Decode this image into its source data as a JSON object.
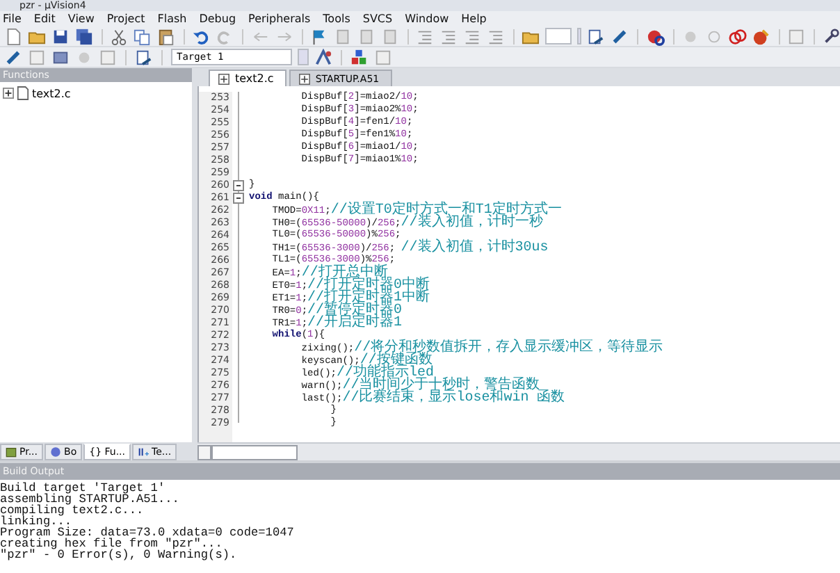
{
  "window": {
    "title": "pzr - µVision4"
  },
  "menu": [
    "File",
    "Edit",
    "View",
    "Project",
    "Flash",
    "Debug",
    "Peripherals",
    "Tools",
    "SVCS",
    "Window",
    "Help"
  ],
  "toolbar": {
    "target": "Target 1"
  },
  "functions_panel": {
    "title": "Functions",
    "items": [
      {
        "label": "text2.c",
        "expanded": false
      }
    ],
    "tabs": [
      {
        "label": "Pr...",
        "selected": false
      },
      {
        "label": "Bo",
        "selected": false
      },
      {
        "label": "{} Fu...",
        "selected": true
      },
      {
        "label": "Te...",
        "selected": false
      }
    ]
  },
  "editor": {
    "tabs": [
      {
        "label": "text2.c",
        "selected": true
      },
      {
        "label": "STARTUP.A51",
        "selected": false
      }
    ],
    "lines": [
      {
        "number": "253",
        "fold_toggle": false,
        "parts": [
          {
            "kind": "code",
            "text": "         DispBuf["
          },
          {
            "kind": "num",
            "text": "2"
          },
          {
            "kind": "code",
            "text": "]=miao2/"
          },
          {
            "kind": "num",
            "text": "10"
          },
          {
            "kind": "code",
            "text": ";"
          }
        ]
      },
      {
        "number": "254",
        "fold_toggle": false,
        "parts": [
          {
            "kind": "code",
            "text": "         DispBuf["
          },
          {
            "kind": "num",
            "text": "3"
          },
          {
            "kind": "code",
            "text": "]=miao2%"
          },
          {
            "kind": "num",
            "text": "10"
          },
          {
            "kind": "code",
            "text": ";"
          }
        ]
      },
      {
        "number": "255",
        "fold_toggle": false,
        "parts": [
          {
            "kind": "code",
            "text": "         DispBuf["
          },
          {
            "kind": "num",
            "text": "4"
          },
          {
            "kind": "code",
            "text": "]=fen1/"
          },
          {
            "kind": "num",
            "text": "10"
          },
          {
            "kind": "code",
            "text": ";"
          }
        ]
      },
      {
        "number": "256",
        "fold_toggle": false,
        "parts": [
          {
            "kind": "code",
            "text": "         DispBuf["
          },
          {
            "kind": "num",
            "text": "5"
          },
          {
            "kind": "code",
            "text": "]=fen1%"
          },
          {
            "kind": "num",
            "text": "10"
          },
          {
            "kind": "code",
            "text": ";"
          }
        ]
      },
      {
        "number": "257",
        "fold_toggle": false,
        "parts": [
          {
            "kind": "code",
            "text": "         DispBuf["
          },
          {
            "kind": "num",
            "text": "6"
          },
          {
            "kind": "code",
            "text": "]=miao1/"
          },
          {
            "kind": "num",
            "text": "10"
          },
          {
            "kind": "code",
            "text": ";"
          }
        ]
      },
      {
        "number": "258",
        "fold_toggle": false,
        "parts": [
          {
            "kind": "code",
            "text": "         DispBuf["
          },
          {
            "kind": "num",
            "text": "7"
          },
          {
            "kind": "code",
            "text": "]=miao1%"
          },
          {
            "kind": "num",
            "text": "10"
          },
          {
            "kind": "code",
            "text": ";"
          }
        ]
      },
      {
        "number": "259",
        "fold_toggle": false
      },
      {
        "number": "260",
        "fold_toggle": true,
        "parts": [
          {
            "kind": "code",
            "text": "}"
          }
        ]
      },
      {
        "number": "261",
        "fold_toggle": true,
        "parts": [
          {
            "kind": "kw",
            "text": "void"
          },
          {
            "kind": "code",
            "text": " main(){"
          }
        ]
      },
      {
        "number": "262",
        "fold_toggle": false,
        "parts": [
          {
            "kind": "code",
            "text": "    TMOD="
          },
          {
            "kind": "num",
            "text": "0X11"
          },
          {
            "kind": "code",
            "text": ";"
          },
          {
            "kind": "comment",
            "text": "//设置T0定时方式一和T1定时方式一"
          }
        ]
      },
      {
        "number": "263",
        "fold_toggle": false,
        "parts": [
          {
            "kind": "code",
            "text": "    TH0=("
          },
          {
            "kind": "num",
            "text": "65536-50000"
          },
          {
            "kind": "code",
            "text": ")/"
          },
          {
            "kind": "num",
            "text": "256"
          },
          {
            "kind": "code",
            "text": ";"
          },
          {
            "kind": "comment",
            "text": "//装入初值，计时一秒"
          }
        ]
      },
      {
        "number": "264",
        "fold_toggle": false,
        "parts": [
          {
            "kind": "code",
            "text": "    TL0=("
          },
          {
            "kind": "num",
            "text": "65536-50000"
          },
          {
            "kind": "code",
            "text": ")%"
          },
          {
            "kind": "num",
            "text": "256"
          },
          {
            "kind": "code",
            "text": ";"
          }
        ]
      },
      {
        "number": "265",
        "fold_toggle": false,
        "parts": [
          {
            "kind": "code",
            "text": "    TH1=("
          },
          {
            "kind": "num",
            "text": "65536-3000"
          },
          {
            "kind": "code",
            "text": ")/"
          },
          {
            "kind": "num",
            "text": "256"
          },
          {
            "kind": "code",
            "text": "; "
          },
          {
            "kind": "comment",
            "text": "//装入初值，计时30us"
          }
        ]
      },
      {
        "number": "266",
        "fold_toggle": false,
        "parts": [
          {
            "kind": "code",
            "text": "    TL1=("
          },
          {
            "kind": "num",
            "text": "65536-3000"
          },
          {
            "kind": "code",
            "text": ")%"
          },
          {
            "kind": "num",
            "text": "256"
          },
          {
            "kind": "code",
            "text": ";"
          }
        ]
      },
      {
        "number": "267",
        "fold_toggle": false,
        "parts": [
          {
            "kind": "code",
            "text": "    EA="
          },
          {
            "kind": "num",
            "text": "1"
          },
          {
            "kind": "code",
            "text": ";"
          },
          {
            "kind": "comment",
            "text": "//打开总中断"
          }
        ]
      },
      {
        "number": "268",
        "fold_toggle": false,
        "parts": [
          {
            "kind": "code",
            "text": "    ET0="
          },
          {
            "kind": "num",
            "text": "1"
          },
          {
            "kind": "code",
            "text": ";"
          },
          {
            "kind": "comment",
            "text": "//打开定时器0中断"
          }
        ]
      },
      {
        "number": "269",
        "fold_toggle": false,
        "parts": [
          {
            "kind": "code",
            "text": "    ET1="
          },
          {
            "kind": "num",
            "text": "1"
          },
          {
            "kind": "code",
            "text": ";"
          },
          {
            "kind": "comment",
            "text": "//打开定时器1中断"
          }
        ]
      },
      {
        "number": "270",
        "fold_toggle": false,
        "parts": [
          {
            "kind": "code",
            "text": "    TR0="
          },
          {
            "kind": "num",
            "text": "0"
          },
          {
            "kind": "code",
            "text": ";"
          },
          {
            "kind": "comment",
            "text": "//暂停定时器0"
          }
        ]
      },
      {
        "number": "271",
        "fold_toggle": false,
        "parts": [
          {
            "kind": "code",
            "text": "    TR1="
          },
          {
            "kind": "num",
            "text": "1"
          },
          {
            "kind": "code",
            "text": ";"
          },
          {
            "kind": "comment",
            "text": "//开启定时器1"
          }
        ]
      },
      {
        "number": "272",
        "fold_toggle": false,
        "parts": [
          {
            "kind": "kw",
            "text": "    while"
          },
          {
            "kind": "code",
            "text": "("
          },
          {
            "kind": "num",
            "text": "1"
          },
          {
            "kind": "code",
            "text": "){"
          }
        ]
      },
      {
        "number": "273",
        "fold_toggle": false,
        "parts": [
          {
            "kind": "code",
            "text": "         zixing();"
          },
          {
            "kind": "comment",
            "text": "//将分和秒数值拆开，存入显示缓冲区，等待显示"
          }
        ]
      },
      {
        "number": "274",
        "fold_toggle": false,
        "parts": [
          {
            "kind": "code",
            "text": "         keyscan();"
          },
          {
            "kind": "comment",
            "text": "//按键函数"
          }
        ]
      },
      {
        "number": "275",
        "fold_toggle": false,
        "parts": [
          {
            "kind": "code",
            "text": "         led();"
          },
          {
            "kind": "comment",
            "text": "//功能指示led"
          }
        ]
      },
      {
        "number": "276",
        "fold_toggle": false,
        "parts": [
          {
            "kind": "code",
            "text": "         warn();"
          },
          {
            "kind": "comment",
            "text": "//当时间少于十秒时，警告函数"
          }
        ]
      },
      {
        "number": "277",
        "fold_toggle": false,
        "parts": [
          {
            "kind": "code",
            "text": "         last();"
          },
          {
            "kind": "comment",
            "text": "//比赛结束，显示lose和win 函数"
          }
        ]
      },
      {
        "number": "278",
        "fold_toggle": false,
        "parts": [
          {
            "kind": "code",
            "text": "              }"
          }
        ]
      },
      {
        "number": "279",
        "fold_toggle": false,
        "parts": [
          {
            "kind": "code",
            "text": "              }"
          }
        ]
      }
    ]
  },
  "build_output": {
    "title": "Build Output",
    "lines": [
      "Build target 'Target 1'",
      "assembling STARTUP.A51...",
      "compiling text2.c...",
      "linking...",
      "Program Size: data=73.0 xdata=0 code=1047",
      "creating hex file from \"pzr\"...",
      "\"pzr\" - 0 Error(s), 0 Warning(s)."
    ]
  }
}
